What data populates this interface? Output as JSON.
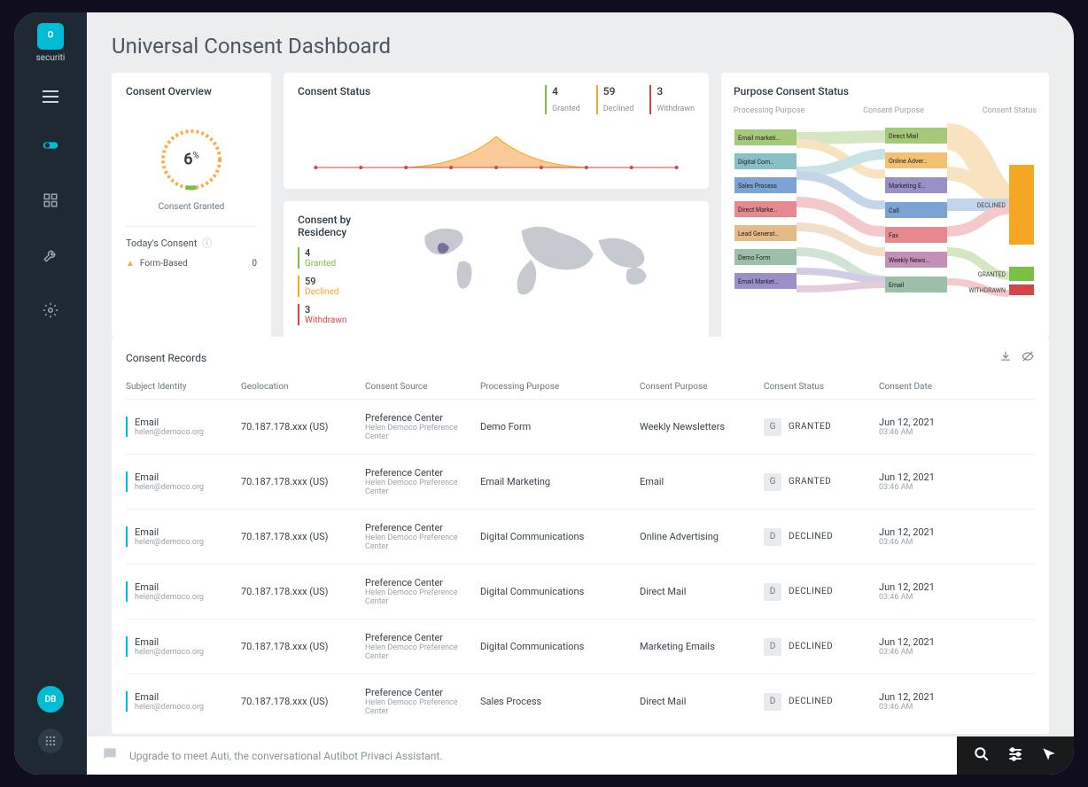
{
  "brand": {
    "name": "securiti"
  },
  "user": {
    "initials": "DB"
  },
  "page_title": "Universal Consent Dashboard",
  "overview": {
    "title": "Consent Overview",
    "gauge_value": "6",
    "gauge_unit": "%",
    "gauge_label": "Consent Granted",
    "today_title": "Today's Consent",
    "form_based_label": "Form-Based",
    "form_based_value": "0"
  },
  "status": {
    "title": "Consent Status",
    "granted": {
      "num": "4",
      "lbl": "Granted"
    },
    "declined": {
      "num": "59",
      "lbl": "Declined"
    },
    "withdrawn": {
      "num": "3",
      "lbl": "Withdrawn"
    }
  },
  "residency": {
    "title": "Consent by Residency",
    "granted": {
      "num": "4",
      "lbl": "Granted"
    },
    "declined": {
      "num": "59",
      "lbl": "Declined"
    },
    "withdrawn": {
      "num": "3",
      "lbl": "Withdrawn"
    }
  },
  "purpose": {
    "title": "Purpose Consent Status",
    "col1": "Processing Purpose",
    "col2": "Consent Purpose",
    "col3": "Consent Status",
    "processing": [
      "Email marketi…",
      "Digital Com…",
      "Sales Process",
      "Direct Marke…",
      "Lead Generat…",
      "Demo Form",
      "Email Market…"
    ],
    "consent_purposes": [
      "Direct Mail",
      "Online Adver…",
      "Marketing E…",
      "Call",
      "Fax",
      "Weekly News…",
      "Email"
    ],
    "statuses": [
      "DECLINED",
      "GRANTED",
      "WITHDRAWN"
    ]
  },
  "records": {
    "title": "Consent Records",
    "headers": {
      "identity": "Subject Identity",
      "geo": "Geolocation",
      "source": "Consent Source",
      "processing": "Processing Purpose",
      "purpose": "Consent Purpose",
      "status": "Consent Status",
      "date": "Consent Date"
    },
    "rows": [
      {
        "identity_prim": "Email",
        "identity_sec": "helen@democo.org",
        "geo": "70.187.178.xxx (US)",
        "source_prim": "Preference Center",
        "source_sec": "Helen Democo Preference Center",
        "processing": "Demo Form",
        "purpose": "Weekly Newsletters",
        "status_letter": "G",
        "status_txt": "GRANTED",
        "date_prim": "Jun 12, 2021",
        "date_sec": "03:46 AM"
      },
      {
        "identity_prim": "Email",
        "identity_sec": "helen@democo.org",
        "geo": "70.187.178.xxx (US)",
        "source_prim": "Preference Center",
        "source_sec": "Helen Democo Preference Center",
        "processing": "Email Marketing",
        "purpose": "Email",
        "status_letter": "G",
        "status_txt": "GRANTED",
        "date_prim": "Jun 12, 2021",
        "date_sec": "03:46 AM"
      },
      {
        "identity_prim": "Email",
        "identity_sec": "helen@democo.org",
        "geo": "70.187.178.xxx (US)",
        "source_prim": "Preference Center",
        "source_sec": "Helen Democo Preference Center",
        "processing": "Digital Communications",
        "purpose": "Online Advertising",
        "status_letter": "D",
        "status_txt": "DECLINED",
        "date_prim": "Jun 12, 2021",
        "date_sec": "03:46 AM"
      },
      {
        "identity_prim": "Email",
        "identity_sec": "helen@democo.org",
        "geo": "70.187.178.xxx (US)",
        "source_prim": "Preference Center",
        "source_sec": "Helen Democo Preference Center",
        "processing": "Digital Communications",
        "purpose": "Direct Mail",
        "status_letter": "D",
        "status_txt": "DECLINED",
        "date_prim": "Jun 12, 2021",
        "date_sec": "03:46 AM"
      },
      {
        "identity_prim": "Email",
        "identity_sec": "helen@democo.org",
        "geo": "70.187.178.xxx (US)",
        "source_prim": "Preference Center",
        "source_sec": "Helen Democo Preference Center",
        "processing": "Digital Communications",
        "purpose": "Marketing Emails",
        "status_letter": "D",
        "status_txt": "DECLINED",
        "date_prim": "Jun 12, 2021",
        "date_sec": "03:46 AM"
      },
      {
        "identity_prim": "Email",
        "identity_sec": "helen@democo.org",
        "geo": "70.187.178.xxx (US)",
        "source_prim": "Preference Center",
        "source_sec": "Helen Democo Preference Center",
        "processing": "Sales Process",
        "purpose": "Direct Mail",
        "status_letter": "D",
        "status_txt": "DECLINED",
        "date_prim": "Jun 12, 2021",
        "date_sec": "03:46 AM"
      }
    ]
  },
  "chat": {
    "placeholder": "Upgrade to meet Auti, the conversational Autibot Privaci Assistant."
  },
  "chart_data": {
    "type": "area",
    "title": "Consent Status",
    "x": [
      0,
      1,
      2,
      3,
      4,
      5,
      6,
      7,
      8
    ],
    "values": [
      0,
      0,
      5,
      20,
      55,
      20,
      5,
      0,
      0
    ],
    "ylim": [
      0,
      60
    ]
  },
  "colors": {
    "accent": "#00bcd4",
    "granted": "#7bc043",
    "declined": "#f5a623",
    "withdrawn": "#d64545",
    "sidebar": "#1e2933"
  }
}
